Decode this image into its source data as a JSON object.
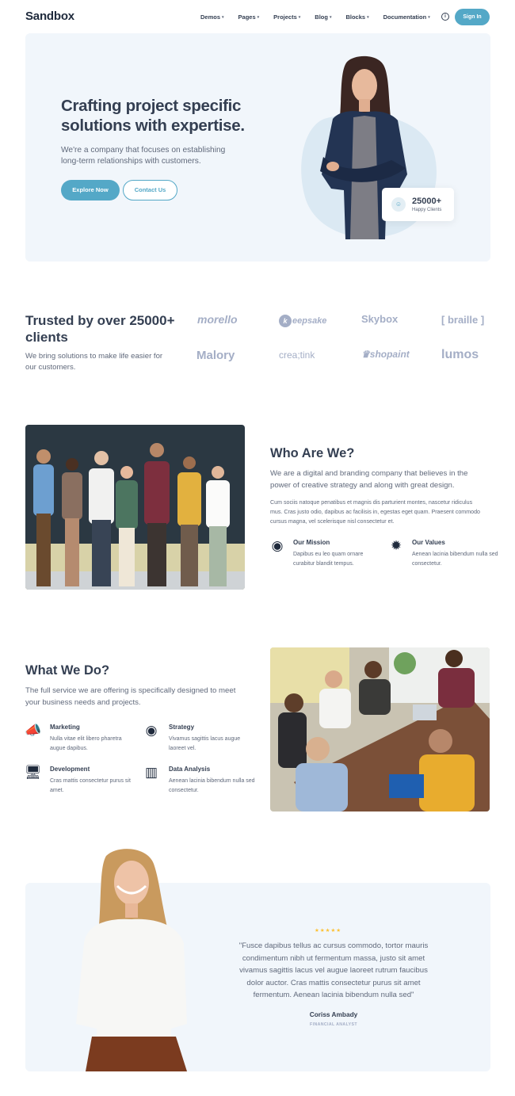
{
  "brand": "Sandbox",
  "nav": {
    "items": [
      "Demos",
      "Pages",
      "Projects",
      "Blog",
      "Blocks",
      "Documentation"
    ],
    "info_icon": "info-circle-icon",
    "signin_label": "Sign In"
  },
  "hero": {
    "title": "Crafting project specific solutions with expertise.",
    "subtitle": "We're a company that focuses on establishing long-term relationships with customers.",
    "explore_label": "Explore Now",
    "contact_label": "Contact Us",
    "stat_number": "25000+",
    "stat_label": "Happy Clients"
  },
  "clients": {
    "title": "Trusted by over 25000+ clients",
    "subtitle": "We bring solutions to make life easier for our customers.",
    "logos": [
      "morello",
      "eepsake",
      "Skybox",
      "[ braille ]",
      "Malory",
      "crea;tink",
      "shopaint",
      "lumos"
    ]
  },
  "who": {
    "title": "Who Are We?",
    "lead": "We are a digital and branding company that believes in the power of creative strategy and along with great design.",
    "body": "Cum sociis natoque penatibus et magnis dis parturient montes, nascetur ridiculus mus. Cras justo odio, dapibus ac facilisis in, egestas eget quam. Praesent commodo cursus magna, vel scelerisque nisl consectetur et.",
    "features": [
      {
        "title": "Our Mission",
        "text": "Dapibus eu leo quam ornare curabitur blandit tempus.",
        "icon": "target-icon"
      },
      {
        "title": "Our Values",
        "text": "Aenean lacinia bibendum nulla sed consectetur.",
        "icon": "award-icon"
      }
    ]
  },
  "what": {
    "title": "What We Do?",
    "lead": "The full service we are offering is specifically designed to meet your business needs and projects.",
    "services": [
      {
        "title": "Marketing",
        "text": "Nulla vitae elit libero pharetra augue dapibus.",
        "icon": "megaphone-icon"
      },
      {
        "title": "Strategy",
        "text": "Vivamus sagittis lacus augue laoreet vel.",
        "icon": "target-icon"
      },
      {
        "title": "Development",
        "text": "Cras mattis consectetur purus sit amet.",
        "icon": "monitor-icon"
      },
      {
        "title": "Data Analysis",
        "text": "Aenean lacinia bibendum nulla sed consectetur.",
        "icon": "bar-chart-icon"
      }
    ]
  },
  "testimonial": {
    "stars": "★★★★★",
    "quote": "\"Fusce dapibus tellus ac cursus commodo, tortor mauris condimentum nibh ut fermentum massa, justo sit amet vivamus sagittis lacus vel augue laoreet rutrum faucibus dolor auctor. Cras mattis consectetur purus sit amet fermentum. Aenean lacinia bibendum nulla sed\"",
    "name": "Coriss Ambady",
    "role": "FINANCIAL ANALYST"
  },
  "colors": {
    "accent": "#54a8c7",
    "heading": "#343f52",
    "muted": "#60697b",
    "soft_bg": "#f1f6fb",
    "star": "#fcc032"
  }
}
